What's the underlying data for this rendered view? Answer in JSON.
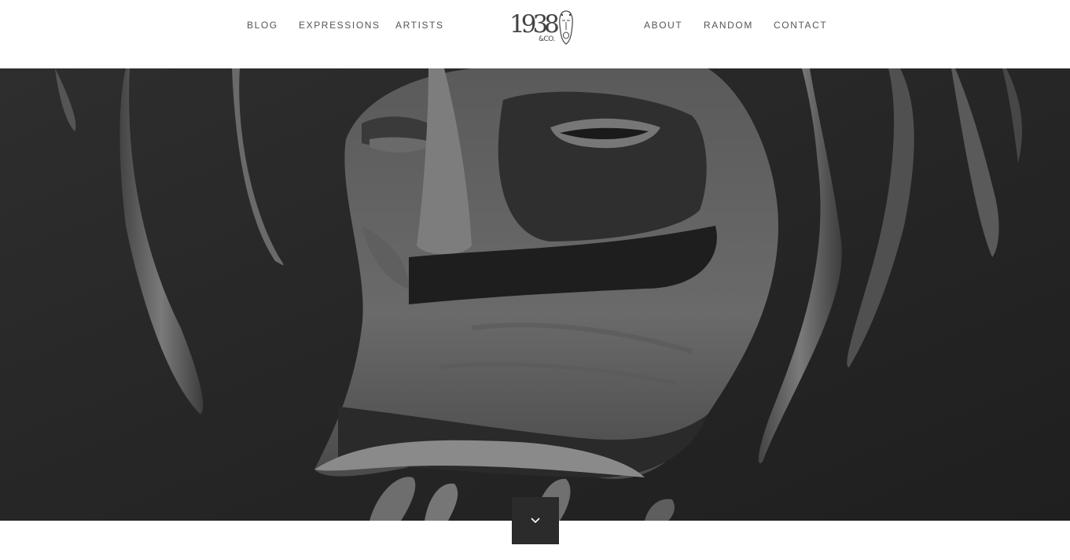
{
  "nav": {
    "left": [
      "BLOG",
      "EXPRESSIONS",
      "ARTISTS"
    ],
    "right": [
      "ABOUT",
      "RANDOM",
      "CONTACT"
    ]
  },
  "logo": {
    "number": "1938",
    "suffix": "&CO."
  },
  "hero": {
    "image": "charcoal drawing of a mask face, grayscale"
  },
  "icons": {
    "scroll": "chevron-down-icon",
    "logo_mark": "mask-icon"
  },
  "colors": {
    "nav_text": "#555555",
    "hero_bg": "#2a2a2a",
    "button_bg": "#2b2b2b"
  }
}
